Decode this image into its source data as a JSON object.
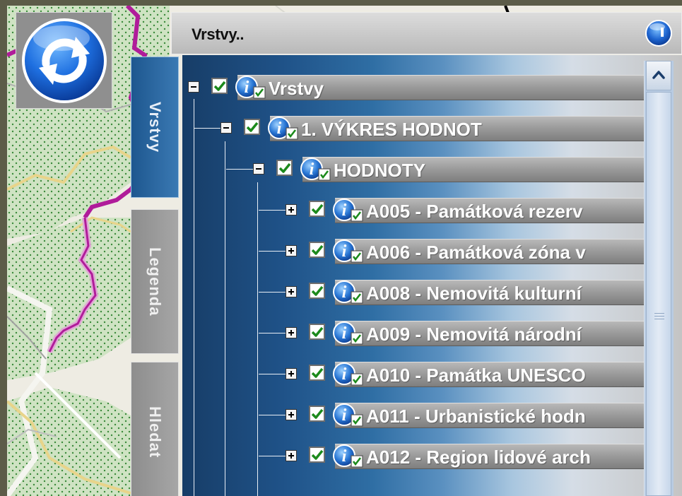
{
  "panel": {
    "title": "Vrstvy.."
  },
  "tabs": [
    {
      "label": "Vrstvy",
      "active": true
    },
    {
      "label": "Legenda",
      "active": false
    },
    {
      "label": "Hledat",
      "active": false
    }
  ],
  "tree": [
    {
      "label": "Vrstvy",
      "level": 0,
      "expanded": true,
      "checked": true
    },
    {
      "label": "1. VÝKRES HODNOT",
      "level": 1,
      "expanded": true,
      "checked": true
    },
    {
      "label": "HODNOTY",
      "level": 2,
      "expanded": true,
      "checked": true
    },
    {
      "label": "A005 - Památková rezerv",
      "level": 3,
      "expanded": false,
      "checked": true
    },
    {
      "label": "A006 - Památková zóna v",
      "level": 3,
      "expanded": false,
      "checked": true
    },
    {
      "label": "A008 - Nemovitá kulturní",
      "level": 3,
      "expanded": false,
      "checked": true
    },
    {
      "label": "A009 - Nemovitá národní",
      "level": 3,
      "expanded": false,
      "checked": true
    },
    {
      "label": "A010 - Památka UNESCO",
      "level": 3,
      "expanded": false,
      "checked": true
    },
    {
      "label": "A011 - Urbanistické hodn",
      "level": 3,
      "expanded": false,
      "checked": true
    },
    {
      "label": "A012 - Region lidové arch",
      "level": 3,
      "expanded": false,
      "checked": true
    }
  ],
  "colors": {
    "accent": "#2b62a2",
    "panel": "#9c9c9c",
    "map_route": "#b01c9a",
    "checkmark": "#1c8a1c"
  },
  "icons": {
    "refresh": "refresh-icon",
    "info": "info-icon",
    "scroll_up": "chevron-up-icon"
  }
}
